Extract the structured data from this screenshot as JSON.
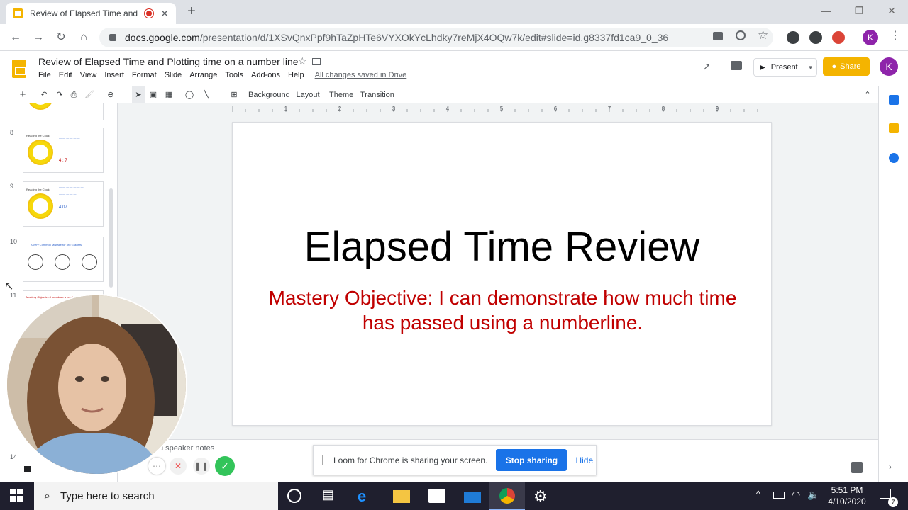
{
  "browser": {
    "tab_title": "Review of Elapsed Time and",
    "tab_close": "✕",
    "new_tab": "+",
    "url_host": "docs.google.com",
    "url_path": "/presentation/d/1XSvQnxPpf9hTaZpHTe6VYXOkYcLhdky7reMjX4OQw7k/edit#slide=id.g8337fd1ca9_0_36",
    "profile_initial": "K"
  },
  "docs": {
    "title": "Review of Elapsed Time and Plotting time on a number line",
    "menu": [
      "File",
      "Edit",
      "View",
      "Insert",
      "Format",
      "Slide",
      "Arrange",
      "Tools",
      "Add-ons",
      "Help"
    ],
    "saved_status": "All changes saved in Drive",
    "present_label": "Present",
    "share_label": "Share",
    "profile_initial": "K"
  },
  "edit_toolbar": {
    "background": "Background",
    "layout": "Layout",
    "theme": "Theme",
    "transition": "Transition"
  },
  "ruler_ticks": [
    "1",
    "2",
    "3",
    "4",
    "5",
    "6",
    "7",
    "8",
    "9"
  ],
  "filmstrip": {
    "slides": [
      {
        "number": "8",
        "title": "Reading the Clock",
        "answer": "4 : 7"
      },
      {
        "number": "9",
        "title": "Reading the Clock",
        "answer": "4:07"
      },
      {
        "number": "10",
        "title": "A Very Common Mistake for 3rd Graders!"
      },
      {
        "number": "11",
        "title": "Mastery Objective: I can draw a number time it is"
      },
      {
        "number": "14"
      }
    ]
  },
  "slide": {
    "title": "Elapsed Time Review",
    "subtitle": "Mastery Objective: I can demonstrate how much time has passed using a numberline."
  },
  "notes": {
    "placeholder": "d speaker notes"
  },
  "loom": {
    "message": "Loom for Chrome is sharing your screen.",
    "stop_label": "Stop sharing",
    "hide_label": "Hide"
  },
  "taskbar": {
    "search_placeholder": "Type here to search",
    "time": "5:51 PM",
    "date": "4/10/2020",
    "notification_count": "7"
  },
  "colors": {
    "slide_subtitle": "#c00000",
    "share_button": "#f4b400",
    "loom_stop": "#1a73e8"
  }
}
